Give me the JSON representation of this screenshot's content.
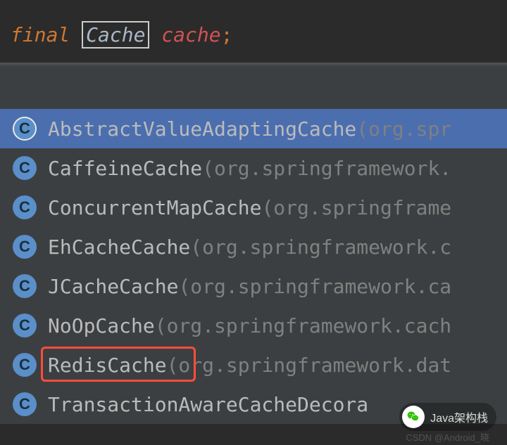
{
  "editor": {
    "keyword": "final",
    "type": "Cache",
    "varName": "cache",
    "terminator": ";"
  },
  "suggestions": [
    {
      "icon": "C",
      "className": "AbstractValueAdaptingCache",
      "package": " (org.spr",
      "selected": true,
      "highlighted": false
    },
    {
      "icon": "C",
      "className": "CaffeineCache",
      "package": " (org.springframework.",
      "selected": false,
      "highlighted": false
    },
    {
      "icon": "C",
      "className": "ConcurrentMapCache",
      "package": " (org.springframe",
      "selected": false,
      "highlighted": false
    },
    {
      "icon": "C",
      "className": "EhCacheCache",
      "package": " (org.springframework.c",
      "selected": false,
      "highlighted": false
    },
    {
      "icon": "C",
      "className": "JCacheCache",
      "package": " (org.springframework.ca",
      "selected": false,
      "highlighted": false
    },
    {
      "icon": "C",
      "className": "NoOpCache",
      "package": " (org.springframework.cach",
      "selected": false,
      "highlighted": false
    },
    {
      "icon": "C",
      "className": "RedisCache",
      "package": " (org.springframework.dat",
      "selected": false,
      "highlighted": true
    },
    {
      "icon": "C",
      "className": "TransactionAwareCacheDecora",
      "package": "",
      "selected": false,
      "highlighted": false
    }
  ],
  "badge": {
    "label": "Java架构栈"
  },
  "watermark": {
    "text": "CSDN @Android_晓"
  }
}
